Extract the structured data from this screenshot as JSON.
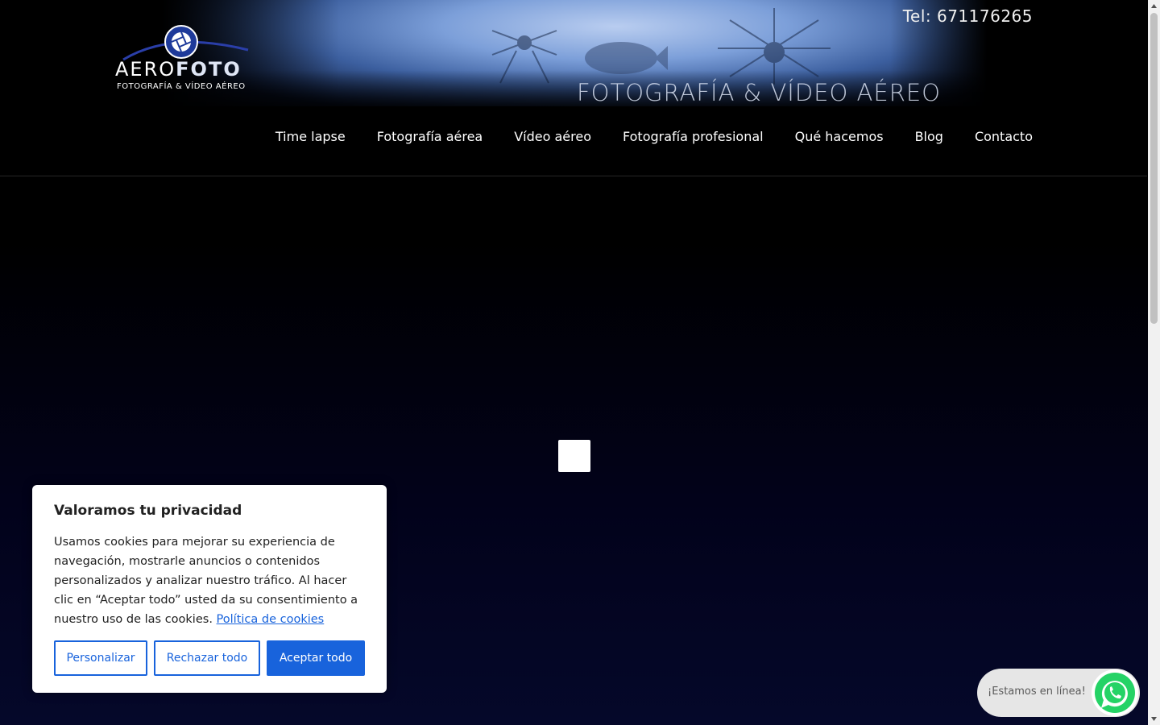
{
  "header": {
    "phone": "Tel: 671176265",
    "logo": {
      "name_light": "AERO",
      "name_bold": "FOTO",
      "subtitle": "FOTOGRAFÍA & VÍDEO AÉREO"
    },
    "banner_tagline": "FOTOGRAFÍA  & VÍDEO AÉREO"
  },
  "nav": {
    "items": [
      {
        "label": "Time lapse"
      },
      {
        "label": "Fotografía aérea"
      },
      {
        "label": "Vídeo aéreo"
      },
      {
        "label": "Fotografía profesional"
      },
      {
        "label": "Qué hacemos"
      },
      {
        "label": "Blog"
      },
      {
        "label": "Contacto"
      }
    ]
  },
  "cookie_banner": {
    "title": "Valoramos tu privacidad",
    "body": "Usamos cookies para mejorar su experiencia de navegación, mostrarle anuncios o contenidos personalizados y analizar nuestro tráfico. Al hacer clic en “Aceptar todo” usted da su consentimiento a nuestro uso de las cookies.",
    "policy_link": "Política de cookies",
    "buttons": {
      "customize": "Personalizar",
      "reject": "Rechazar todo",
      "accept": "Aceptar todo"
    }
  },
  "whatsapp": {
    "label": "¡Estamos en línea!",
    "icon": "whatsapp-icon"
  },
  "colors": {
    "accent": "#1863dc",
    "background": "#000000",
    "whatsapp_green": "#25d366"
  }
}
